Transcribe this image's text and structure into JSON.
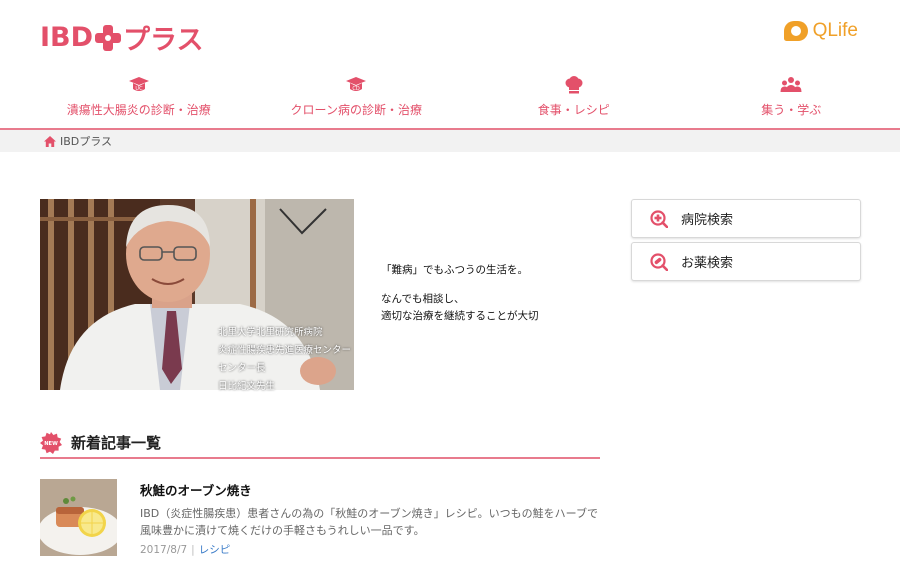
{
  "header": {
    "logo_ibd": "IBD",
    "logo_plus": "プラス",
    "qlife": "QLife"
  },
  "nav": {
    "items": [
      {
        "label": "潰瘍性大腸炎の診断・治療",
        "icon": "graduation-cap-uc-icon"
      },
      {
        "label": "クローン病の診断・治療",
        "icon": "graduation-cap-cd-icon"
      },
      {
        "label": "食事・レシピ",
        "icon": "chef-hat-icon"
      },
      {
        "label": "集う・学ぶ",
        "icon": "people-icon"
      }
    ]
  },
  "breadcrumb": {
    "home": "IBDプラス"
  },
  "hero": {
    "caption": [
      "北里大学北里研究所病院",
      "炎症性腸疾患先進医療センター",
      "センター長",
      "日比紀文先生"
    ],
    "quote1": "「難病」でもふつうの生活を。",
    "quote2": "なんでも相談し、",
    "quote3": "適切な治療を継続することが大切"
  },
  "side": {
    "hospital": "病院検索",
    "medicine": "お薬検索"
  },
  "articles": {
    "section_title": "新着記事一覧",
    "items": [
      {
        "title": "秋鮭のオーブン焼き",
        "desc": "IBD（炎症性腸疾患）患者さんの為の「秋鮭のオーブン焼き」レシピ。いつもの鮭をハーブで風味豊かに漬けて焼くだけの手軽さもうれしい一品です。",
        "date": "2017/8/7",
        "category": "レシピ"
      }
    ]
  },
  "colors": {
    "brand": "#e3506a",
    "qlife": "#f0a028",
    "link": "#3a7bc8"
  }
}
